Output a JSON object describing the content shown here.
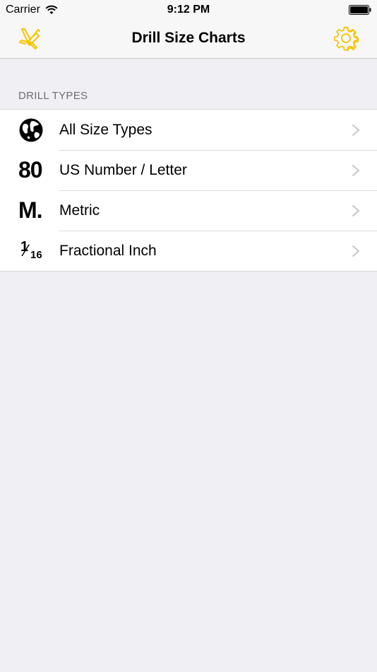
{
  "status_bar": {
    "carrier": "Carrier",
    "time": "9:12 PM",
    "wifi_icon": "wifi-icon",
    "battery_icon": "battery-icon"
  },
  "nav": {
    "title": "Drill Size Charts",
    "left_icon": "swiss-knife-icon",
    "right_icon": "gear-icon",
    "accent_color": "#f5c400"
  },
  "section": {
    "header": "DRILL TYPES"
  },
  "list": {
    "items": [
      {
        "label": "All Size Types",
        "icon": "globe-icon"
      },
      {
        "label": "US Number / Letter",
        "icon_text": "80"
      },
      {
        "label": "Metric",
        "icon_text": "M."
      },
      {
        "label": "Fractional Inch",
        "icon_num": "1",
        "icon_slash": "⁄",
        "icon_den": "16"
      }
    ],
    "chevron_icon": "chevron-right-icon"
  }
}
